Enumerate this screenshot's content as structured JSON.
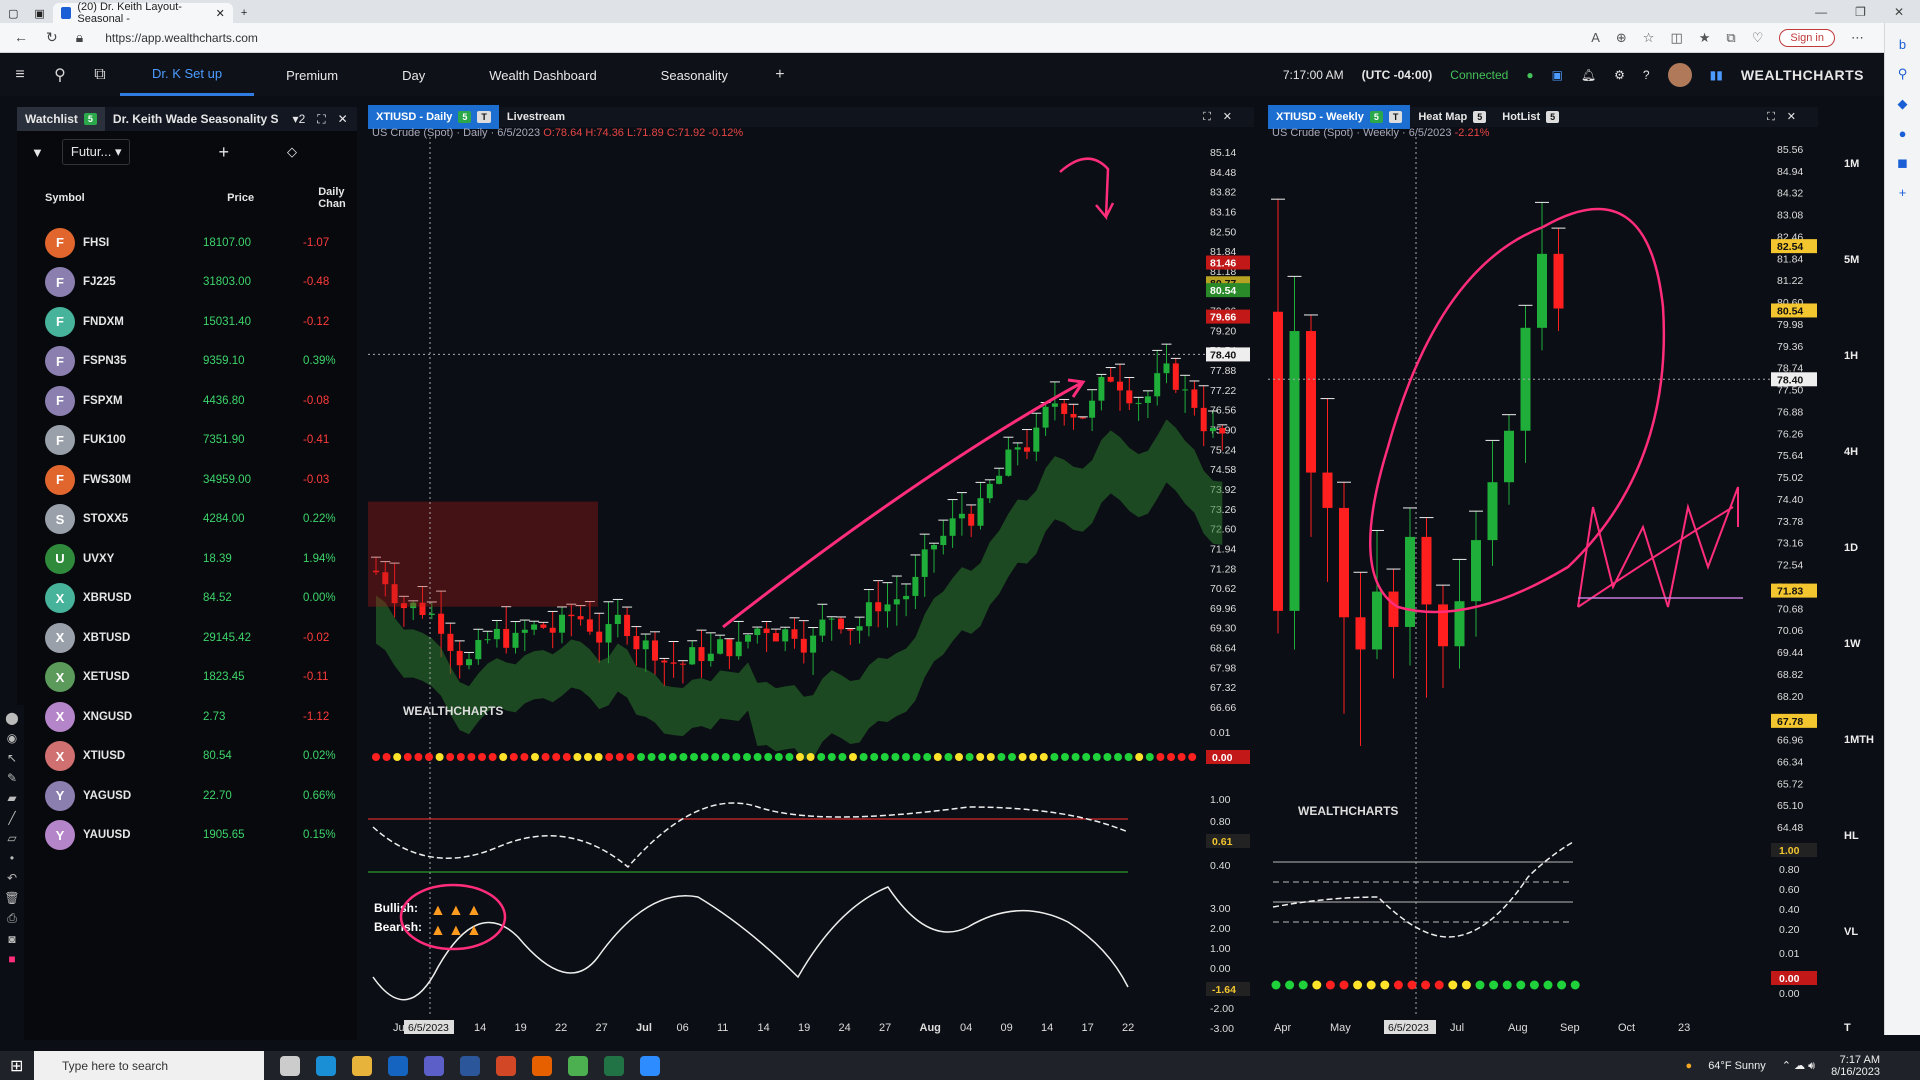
{
  "browser": {
    "tab_title": "(20) Dr. Keith Layout-Seasonal -",
    "url": "https://app.wealthcharts.com",
    "signin": "Sign in"
  },
  "appbar": {
    "tabs": [
      {
        "label": "Dr. K Set up",
        "active": true
      },
      {
        "label": "Premium"
      },
      {
        "label": "Day"
      },
      {
        "label": "Wealth Dashboard"
      },
      {
        "label": "Seasonality"
      }
    ],
    "time": "7:17:00 AM",
    "tz": "(UTC -04:00)",
    "status": "Connected",
    "brand": "WEALTHCHARTS"
  },
  "watchlist": {
    "tab1": "Watchlist",
    "tab1_badge": "5",
    "tab2": "Dr. Keith Wade Seasonality S",
    "tab2_count": "2",
    "filter": "Futur...",
    "headers": {
      "symbol": "Symbol",
      "price": "Price",
      "change": "Daily Chan"
    },
    "rows": [
      {
        "letter": "F",
        "color": "#e0662e",
        "symbol": "FHSI",
        "price": "18107.00",
        "change": "-1.07",
        "neg": true
      },
      {
        "letter": "F",
        "color": "#8b7fb0",
        "symbol": "FJ225",
        "price": "31803.00",
        "change": "-0.48",
        "neg": true
      },
      {
        "letter": "F",
        "color": "#46b39a",
        "symbol": "FNDXM",
        "price": "15031.40",
        "change": "-0.12",
        "neg": true
      },
      {
        "letter": "F",
        "color": "#8b7fb0",
        "symbol": "FSPN35",
        "price": "9359.10",
        "change": "0.39%",
        "neg": false
      },
      {
        "letter": "F",
        "color": "#8b7fb0",
        "symbol": "FSPXM",
        "price": "4436.80",
        "change": "-0.08",
        "neg": true
      },
      {
        "letter": "F",
        "color": "#9aa0aa",
        "symbol": "FUK100",
        "price": "7351.90",
        "change": "-0.41",
        "neg": true
      },
      {
        "letter": "F",
        "color": "#e0662e",
        "symbol": "FWS30M",
        "price": "34959.00",
        "change": "-0.03",
        "neg": true
      },
      {
        "letter": "S",
        "color": "#9aa0aa",
        "symbol": "STOXX5",
        "price": "4284.00",
        "change": "0.22%",
        "neg": false
      },
      {
        "letter": "U",
        "color": "#2f8a3c",
        "symbol": "UVXY",
        "price": "18.39",
        "change": "1.94%",
        "neg": false
      },
      {
        "letter": "X",
        "color": "#46b39a",
        "symbol": "XBRUSD",
        "price": "84.52",
        "change": "0.00%",
        "neg": false
      },
      {
        "letter": "X",
        "color": "#9aa0aa",
        "symbol": "XBTUSD",
        "price": "29145.42",
        "change": "-0.02",
        "neg": true
      },
      {
        "letter": "X",
        "color": "#5b9a5a",
        "symbol": "XETUSD",
        "price": "1823.45",
        "change": "-0.11",
        "neg": true
      },
      {
        "letter": "X",
        "color": "#b585c9",
        "symbol": "XNGUSD",
        "price": "2.73",
        "change": "-1.12",
        "neg": true
      },
      {
        "letter": "X",
        "color": "#d07070",
        "symbol": "XTIUSD",
        "price": "80.54",
        "change": "0.02%",
        "neg": false
      },
      {
        "letter": "Y",
        "color": "#8b7fb0",
        "symbol": "YAGUSD",
        "price": "22.70",
        "change": "0.66%",
        "neg": false
      },
      {
        "letter": "Y",
        "color": "#b585c9",
        "symbol": "YAUUSD",
        "price": "1905.65",
        "change": "0.15%",
        "neg": false
      }
    ]
  },
  "daily_chart": {
    "tab": "XTIUSD - Daily",
    "tab_badge": "5",
    "tab2": "Livestream",
    "title": "US Crude (Spot) · Daily · 6/5/2023",
    "ohlc": "O:78.64 H:74.36 L:71.89 C:71.92 -0.12%",
    "watermark": "WEALTHCHARTS",
    "price_ticks": [
      "85.14",
      "84.48",
      "83.82",
      "83.16",
      "82.50",
      "81.84",
      "81.18",
      "80.52",
      "79.86",
      "79.20",
      "78.54",
      "77.88",
      "77.22",
      "76.56",
      "75.90",
      "75.24",
      "74.58",
      "73.92",
      "73.26",
      "72.60",
      "71.94",
      "71.28",
      "70.62",
      "69.96",
      "69.30",
      "68.64",
      "67.98",
      "67.32",
      "66.66"
    ],
    "labels": {
      "cur1": "81.46",
      "cur2": "80.77",
      "cur3": "80.54",
      "cur4": "79.66",
      "cross": "78.40"
    },
    "ind1_val": "0.00",
    "ind2_ticks": [
      "1.00",
      "0.80",
      "0.60",
      "0.40"
    ],
    "ind2_val": "0.61",
    "ind3_ticks": [
      "3.00",
      "2.00",
      "1.00",
      "0.00",
      "-1.00",
      "-2.00",
      "-3.00"
    ],
    "ind3_val": "-1.64",
    "bullish": "Bullish:",
    "bearish": "Bearish:",
    "x_ticks": [
      "Ju",
      "09",
      "14",
      "19",
      "22",
      "27",
      "Jul",
      "06",
      "11",
      "14",
      "19",
      "24",
      "27",
      "Aug",
      "04",
      "09",
      "14",
      "17",
      "22"
    ],
    "date_label": "6/5/2023"
  },
  "weekly_chart": {
    "tab": "XTIUSD - Weekly",
    "tab_badge": "5",
    "tab2": "Heat Map",
    "tab2_badge": "5",
    "tab3": "HotList",
    "tab3_badge": "5",
    "title": "US Crude (Spot) · Weekly · 6/5/2023",
    "chg": "-2.21%",
    "watermark": "WEALTHCHARTS",
    "price_ticks": [
      "85.56",
      "84.94",
      "84.32",
      "83.08",
      "82.46",
      "81.84",
      "81.22",
      "80.60",
      "79.98",
      "79.36",
      "78.74",
      "77.50",
      "76.88",
      "76.26",
      "75.64",
      "75.02",
      "74.40",
      "73.78",
      "73.16",
      "72.54",
      "71.92",
      "70.68",
      "70.06",
      "69.44",
      "68.82",
      "68.20",
      "67.58",
      "66.96",
      "66.34",
      "65.72",
      "65.10",
      "64.48"
    ],
    "labels": {
      "top": "82.54",
      "cur": "80.54",
      "cross": "78.40",
      "mid": "71.83",
      "low": "67.78"
    },
    "ind1_val": "1.00",
    "ind1_ticks": [
      "0.80",
      "0.60",
      "0.40",
      "0.20"
    ],
    "ind2_ticks": [
      "0.01",
      "0.00"
    ],
    "ind2_val": "0.00",
    "x_ticks": [
      "Apr",
      "May",
      "6/5/2023",
      "Jul",
      "Aug",
      "Sep",
      "Oct",
      "23"
    ]
  },
  "timeframes": [
    "1M",
    "5M",
    "1H",
    "4H",
    "1D",
    "1W",
    "1MTH",
    "HL",
    "VL",
    "T"
  ],
  "taskbar": {
    "search": "Type here to search",
    "weather": "64°F Sunny",
    "time": "7:17 AM",
    "date": "8/16/2023"
  },
  "colors": {
    "bull": "#1fae3a",
    "bear": "#ff1f1f",
    "ink": "#ff2d7a"
  }
}
